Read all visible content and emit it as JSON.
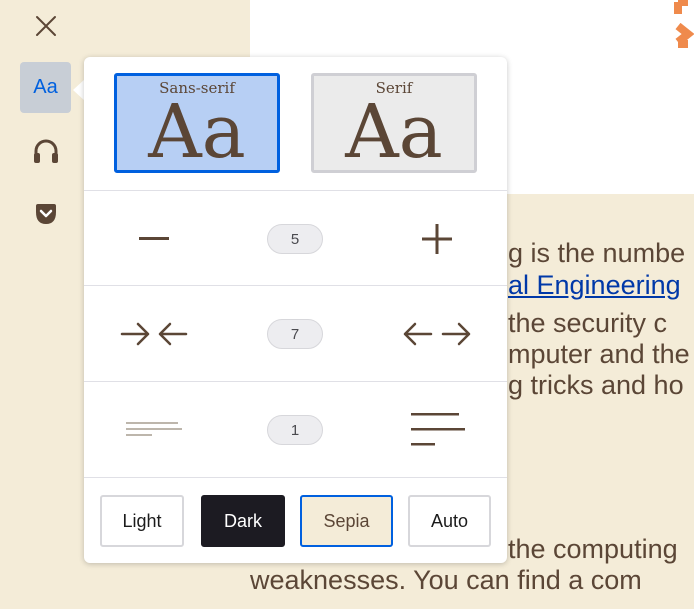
{
  "colors": {
    "sepia_background": "#f4ecd8",
    "sepia_text": "#5b4636",
    "accent": "#0060df",
    "active_font_background": "#b7cff4",
    "logo_orange": "#ef8a4c"
  },
  "sidebar": {
    "close_icon": "close-icon",
    "type_controls_label": "Aa",
    "narrate_icon": "headphones-icon",
    "pocket_icon": "pocket-icon"
  },
  "article": {
    "lines": [
      "g is the numbe",
      "al Engineering",
      " the security c",
      "mputer and the",
      "g tricks and ho",
      "the computing",
      "weaknesses. You can find a com"
    ]
  },
  "popup": {
    "fonts": {
      "sans_label": "Sans-serif",
      "sans_sample": "Aa",
      "serif_label": "Serif",
      "serif_sample": "Aa",
      "selected": "Sans-serif"
    },
    "font_size": {
      "value": "5",
      "decrease_icon": "minus-icon",
      "increase_icon": "plus-icon"
    },
    "content_width": {
      "value": "7",
      "decrease_icon": "arrows-inward-icon",
      "increase_icon": "arrows-outward-icon"
    },
    "line_height": {
      "value": "1",
      "decrease_icon": "lines-tight-icon",
      "increase_icon": "lines-loose-icon"
    },
    "themes": {
      "light": "Light",
      "dark": "Dark",
      "sepia": "Sepia",
      "auto": "Auto",
      "selected": "Sepia"
    }
  }
}
